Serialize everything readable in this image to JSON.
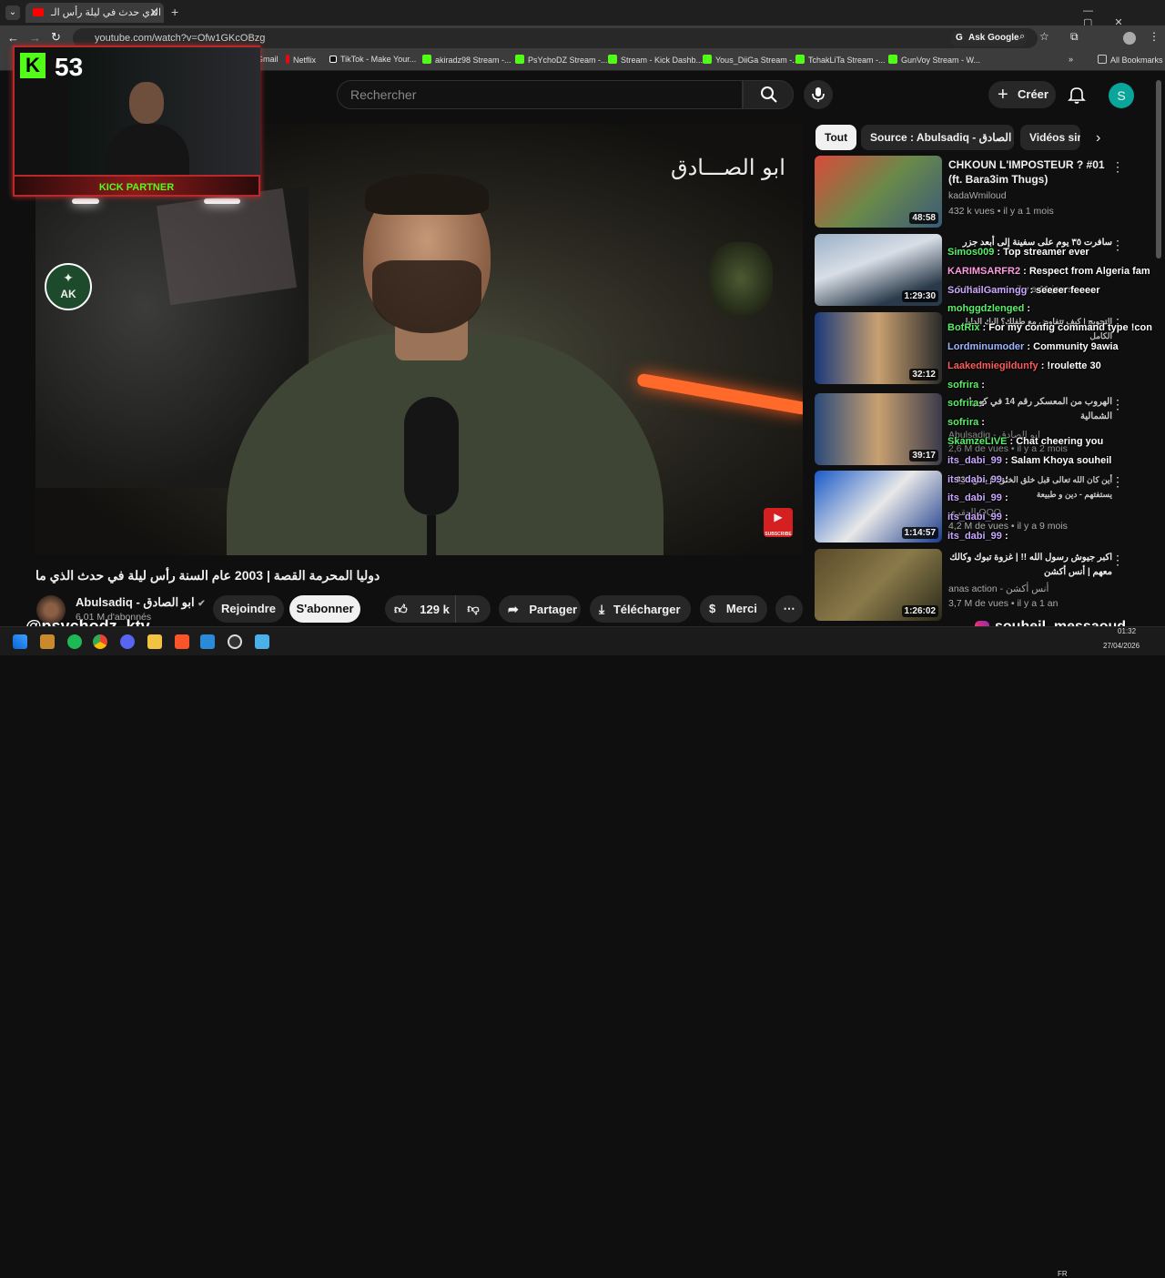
{
  "browser": {
    "tab_title": "ما الذي حدث في ليلة رأس الـ",
    "url": "youtube.com/watch?v=Ofw1GKcOBzg",
    "ask_google": "Ask Google",
    "bookmarks": [
      "Gmail",
      "Netflix",
      "TikTok - Make Your...",
      "akiradz98 Stream -...",
      "PsYchoDZ Stream -...",
      "Stream - Kick Dashb...",
      "Yous_DiiGa Stream -...",
      "TchakLiTa Stream -...",
      "GunVoy Stream - W..."
    ],
    "all_bookmarks": "All Bookmarks"
  },
  "header": {
    "search_placeholder": "Rechercher",
    "create_label": "Créer",
    "avatar_letter": "S"
  },
  "overlay": {
    "kick_count": "53",
    "kick_partner": "KICK PARTNER",
    "ak_logo": "AK",
    "watermark": "ابو الصـــادق",
    "subscribe_badge": "SUBSCRIBE",
    "handle_left": "@psychodz_ktv",
    "handle_right": "souheil_messaoud"
  },
  "video": {
    "title": "دوليا المحرمة القصة | 2003 عام السنة رأس ليلة في حدث الذي ما",
    "channel_name": "Abulsadiq - ابو الصادق",
    "subscribers": "6,01 M d'abonnés",
    "join": "Rejoindre",
    "subscribe": "S'abonner",
    "likes": "129 k",
    "share": "Partager",
    "download": "Télécharger",
    "thanks": "Merci"
  },
  "sidebar": {
    "chips": [
      "Tout",
      "Source : Abulsadiq - ابو الصادق",
      "Vidéos sim"
    ],
    "recs": [
      {
        "title": "CHKOUN L'IMPOSTEUR ? #01 (ft. Bara3im Thugs)",
        "channel": "kadaWmiloud",
        "meta": "432 k vues • il y a 1 mois",
        "duration": "48:58"
      },
      {
        "title": "سافرت ٣٥ يوم على سفينة إلى أبعد جزر",
        "channel": "",
        "meta": "1,9 M de vues • il y a 11 jours",
        "duration": "1:29:30"
      },
      {
        "title": "التحويج | كيف تتفاوض مع طفلك؟ إليك الدليل الكامل",
        "channel": "",
        "meta": "",
        "duration": "32:12"
      },
      {
        "title": "الهروب من المعسكر رقم 14 في كوريا الشمالية",
        "channel": "Abulsadiq - ابو الصادق",
        "meta": "2,6 M de vues • il y a 2 mois",
        "duration": "39:17"
      },
      {
        "title": "أين كان الله تعالى قبل خلق الخلق؟ | بطن 333 يستفتهم - دين و طبيعة",
        "channel": "العقري QQQ",
        "meta": "4,2 M de vues • il y a 9 mois",
        "duration": "1:14:57"
      },
      {
        "title": "اكبر جيوش رسول الله !! | غزوة تبوك وكالك معهم | أنس أكشن",
        "channel": "anas action - أنس أكشن",
        "meta": "3,7 M de vues • il y a 1 an",
        "duration": "1:26:02"
      }
    ]
  },
  "chat": [
    {
      "user": "Simos009",
      "msg": " : Top streamer ever",
      "color": "#5af06a"
    },
    {
      "user": "KARIMSARFR2",
      "msg": " : Respect from Algeria fam",
      "color": "#ff9be0"
    },
    {
      "user": "SouhailGamingg",
      "msg": " : seeeer feeeer",
      "color": "#c7a7ff"
    },
    {
      "user": "mohggdzlenged",
      "msg": " :",
      "color": "#5af06a"
    },
    {
      "user": "BotRix",
      "msg": " : For my config command type !con",
      "color": "#5af06a"
    },
    {
      "user": "Lordminumoder",
      "msg": " : Community 9awia",
      "color": "#9fb6ff"
    },
    {
      "user": "Laakedmiegildunfy",
      "msg": " : !roulette 30",
      "color": "#ff5a5a"
    },
    {
      "user": "sofrira",
      "msg": " :",
      "color": "#5af06a"
    },
    {
      "user": "sofrira",
      "msg": " :",
      "color": "#5af06a"
    },
    {
      "user": "sofrira",
      "msg": " :",
      "color": "#5af06a"
    },
    {
      "user": "SkamzeLIVE",
      "msg": " : Chat cheering you",
      "color": "#5af06a"
    },
    {
      "user": "its_dabi_99",
      "msg": " : Salam Khoya souheil",
      "color": "#c7a7ff"
    },
    {
      "user": "its_dabi_99",
      "msg": " :",
      "color": "#c7a7ff"
    },
    {
      "user": "its_dabi_99",
      "msg": " :",
      "color": "#c7a7ff"
    },
    {
      "user": "its_dabi_99",
      "msg": " :",
      "color": "#c7a7ff"
    },
    {
      "user": "its_dabi_99",
      "msg": " :",
      "color": "#c7a7ff"
    }
  ],
  "taskbar": {
    "time": "01:32",
    "date": "27/04/2026",
    "lang": "FR"
  }
}
